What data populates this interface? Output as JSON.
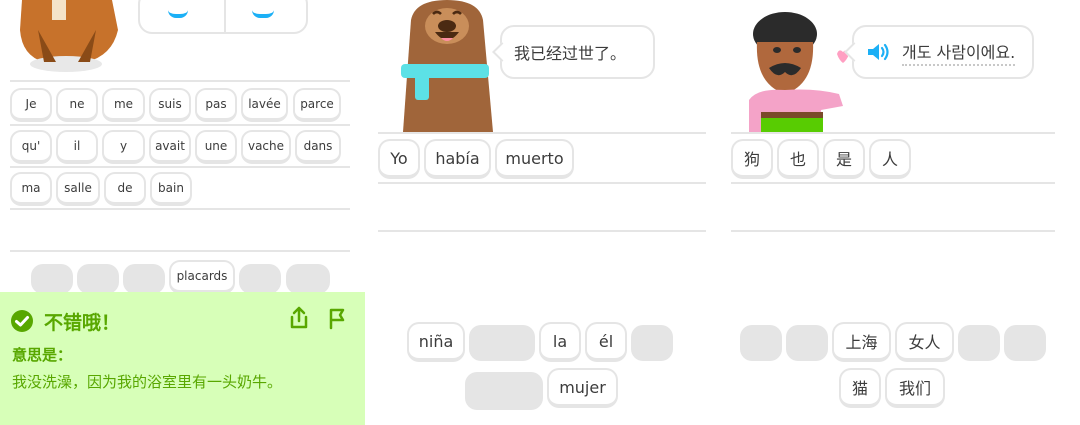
{
  "panel1": {
    "word_rows": [
      [
        "Je",
        "ne",
        "me",
        "suis",
        "pas",
        "lavée",
        "parce"
      ],
      [
        "qu'",
        "il",
        "y",
        "avait",
        "une",
        "vache",
        "dans"
      ],
      [
        "ma",
        "salle",
        "de",
        "bain"
      ]
    ],
    "answer_bank_word": "placards",
    "feedback": {
      "title": "不错哦！",
      "meaning_label": "意思是：",
      "translation": "我没洗澡，因为我的浴室里有一头奶牛。"
    }
  },
  "panel2": {
    "speech": "我已经过世了。",
    "answer_words": [
      "Yo",
      "había",
      "muerto"
    ],
    "bank_row1": [
      "niña",
      "la",
      "él"
    ],
    "bank_row2": [
      "mujer"
    ]
  },
  "panel3": {
    "speech": "개도 사람이에요.",
    "answer_words": [
      "狗",
      "也",
      "是",
      "人"
    ],
    "bank_row1": [
      "上海",
      "女人"
    ],
    "bank_row2": [
      "猫",
      "我们"
    ]
  },
  "colors": {
    "success_bg": "#d7ffb8",
    "success_text": "#58a700",
    "chip_border": "#e5e5e5",
    "speaker_blue": "#1cb0f6"
  },
  "icons": [
    "check-circle-icon",
    "share-icon",
    "flag-icon",
    "speaker-icon"
  ]
}
